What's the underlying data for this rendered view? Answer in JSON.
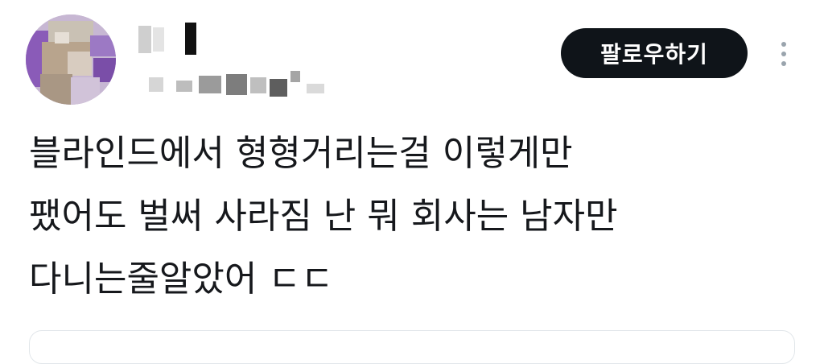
{
  "post": {
    "follow_label": "팔로우하기",
    "text_lines": [
      "블라인드에서 형형거리는걸 이렇게만",
      "팼어도 벌써 사라짐 난 뭐 회사는 남자만",
      "다니는줄알았어 ㄷㄷ"
    ]
  },
  "colors": {
    "button_bg": "#0f1419",
    "button_text": "#ffffff",
    "text": "#16181c",
    "more_dots": "#9aa4ad",
    "avatar_accent": "#8a5bb8"
  },
  "icons": {
    "more": "more-vertical-icon"
  }
}
